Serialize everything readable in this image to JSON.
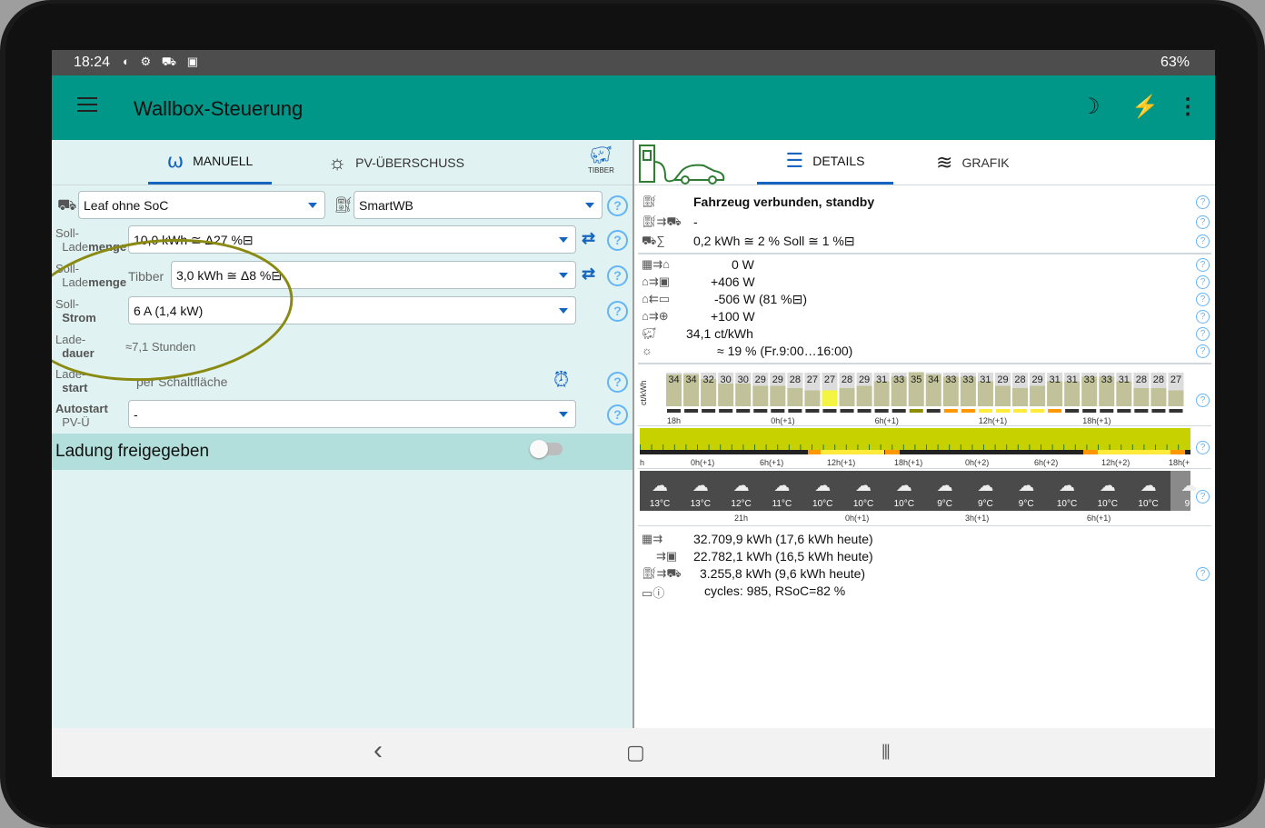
{
  "status": {
    "time": "18:24",
    "icons": "◐ ⚙ ⛟ ▣",
    "battery": "63%"
  },
  "appbar": {
    "title": "Wallbox-Steuerung",
    "moon_icon": "☽",
    "bolt_icon": "⚡",
    "menu_icon": "⋮"
  },
  "tabs_left": [
    {
      "label": "MANUELL"
    },
    {
      "label": "PV-ÜBERSCHUSS"
    }
  ],
  "tibber_label": "TIBBER",
  "tabs_right": [
    {
      "label": "DETAILS"
    },
    {
      "label": "GRAFIK"
    }
  ],
  "vehicle_select": "Leaf ohne SoC",
  "wallbox_select": "SmartWB",
  "soll1": {
    "label1": "Soll-",
    "label2a": "Lade",
    "label2b": "menge",
    "value": "10,0 kWh ≅ Δ27 %⊟"
  },
  "soll2": {
    "label1": "Soll-",
    "label2a": "Lade",
    "label2b": "menge",
    "prefix": "Tibber",
    "value": "3,0 kWh ≅ Δ8 %⊟"
  },
  "strom": {
    "label1": "Soll-",
    "label2": "Strom",
    "value": "6 A (1,4 kW)"
  },
  "dauer": {
    "label1": "Lade-",
    "label2": "dauer",
    "value": "≈7,1 Stunden"
  },
  "start": {
    "label1": "Lade-",
    "label2": "start",
    "value": "per Schaltfläche"
  },
  "autostart": {
    "label1": "Autostart",
    "label2": "PV-Ü",
    "value": "-"
  },
  "freigabe": {
    "label": "Ladung freigegeben",
    "enabled": false
  },
  "details": {
    "status": "Fahrzeug verbunden, standby",
    "line2": "-",
    "line3": "0,2 kWh ≅ 2 % Soll ≅ 1 %⊟",
    "pv": "0 W",
    "house": "+406 W",
    "battery": "-506 W (81 %⊟)",
    "grid": "+100 W",
    "price": "34,1 ct/kWh",
    "sun": "≈ 19 % (Fr.9:00…16:00)"
  },
  "chart_data": {
    "type": "bar",
    "ylabel": "ct/kWh",
    "values": [
      34,
      34,
      32,
      30,
      30,
      29,
      29,
      28,
      27,
      27,
      28,
      29,
      31,
      33,
      35,
      34,
      33,
      33,
      31,
      29,
      28,
      29,
      31,
      31,
      33,
      33,
      31,
      28,
      28,
      27
    ],
    "highlight_index": 9,
    "ticks": [
      "18h",
      "0h(+1)",
      "6h(+1)",
      "12h(+1)",
      "18h(+1)"
    ]
  },
  "pv_strip_ticks": [
    "h",
    "0h(+1)",
    "6h(+1)",
    "12h(+1)",
    "18h(+1)",
    "0h(+2)",
    "6h(+2)",
    "12h(+2)",
    "18h(+"
  ],
  "weather": {
    "temps": [
      "13°C",
      "13°C",
      "12°C",
      "11°C",
      "10°C",
      "10°C",
      "10°C",
      "9°C",
      "9°C",
      "9°C",
      "10°C",
      "10°C",
      "10°C",
      "9°"
    ],
    "ticks": [
      "21h",
      "0h(+1)",
      "3h(+1)",
      "6h(+1)"
    ]
  },
  "totals": {
    "pv": "32.709,9 kWh  (17,6 kWh heute)",
    "house": "22.782,1 kWh  (16,5 kWh heute)",
    "car": "3.255,8 kWh  (9,6 kWh heute)",
    "battery": "cycles: 985, RSoC=82 %"
  },
  "nav": {
    "back": "‹",
    "home": "▢",
    "recent": "⦀"
  }
}
